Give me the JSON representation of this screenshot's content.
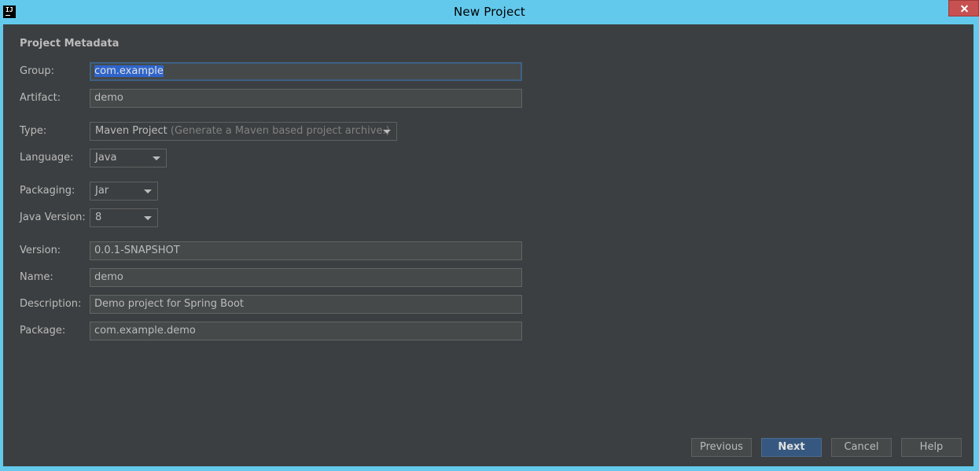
{
  "window": {
    "title": "New Project",
    "app_icon_text": "IJ"
  },
  "section": {
    "title": "Project Metadata"
  },
  "fields": {
    "group": {
      "label": "Group:",
      "value": "com.example"
    },
    "artifact": {
      "label": "Artifact:",
      "value": "demo"
    },
    "type": {
      "label": "Type:",
      "value": "Maven Project",
      "hint": "(Generate a Maven based project archive.)"
    },
    "language": {
      "label": "Language:",
      "value": "Java"
    },
    "packaging": {
      "label": "Packaging:",
      "value": "Jar"
    },
    "java_version": {
      "label": "Java Version:",
      "value": "8"
    },
    "version": {
      "label": "Version:",
      "value": "0.0.1-SNAPSHOT"
    },
    "name": {
      "label": "Name:",
      "value": "demo"
    },
    "description": {
      "label": "Description:",
      "value": "Demo project for Spring Boot"
    },
    "package": {
      "label": "Package:",
      "value": "com.example.demo"
    }
  },
  "buttons": {
    "previous": "Previous",
    "next": "Next",
    "cancel": "Cancel",
    "help": "Help"
  },
  "colors": {
    "title_bar": "#63c9ec",
    "dialog_background": "#3c3f41",
    "default_button": "#365880",
    "close_button": "#c75050"
  }
}
